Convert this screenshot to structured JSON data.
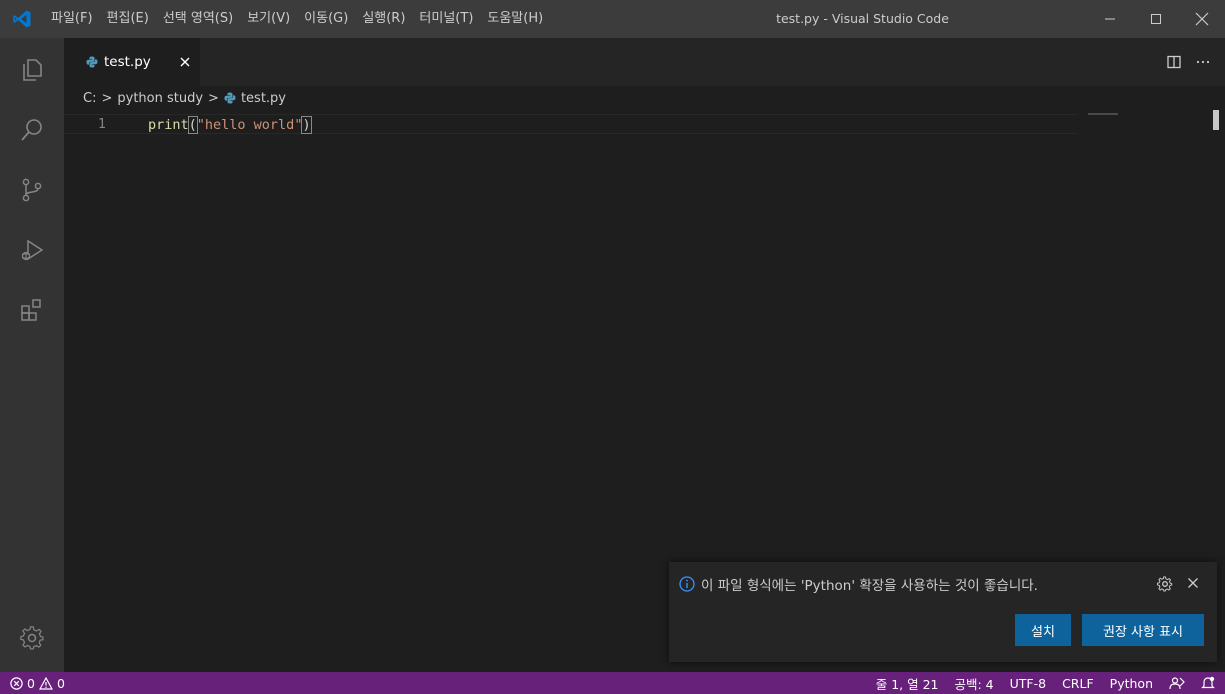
{
  "window": {
    "title": "test.py - Visual Studio Code",
    "controls": [
      "minimize-icon",
      "maximize-icon",
      "close-icon"
    ]
  },
  "menu": {
    "items": [
      {
        "label": "파일(F)"
      },
      {
        "label": "편집(E)"
      },
      {
        "label": "선택 영역(S)"
      },
      {
        "label": "보기(V)"
      },
      {
        "label": "이동(G)"
      },
      {
        "label": "실행(R)"
      },
      {
        "label": "터미널(T)"
      },
      {
        "label": "도움말(H)"
      }
    ]
  },
  "activity_bar": {
    "icons": [
      "explorer-icon",
      "search-icon",
      "source-control-icon",
      "run-debug-icon",
      "extensions-icon",
      "settings-gear-icon"
    ]
  },
  "tabs": [
    {
      "label": "test.py",
      "active": true
    }
  ],
  "breadcrumb": {
    "drive": "C:",
    "folder": "python study",
    "file": "test.py",
    "separator": ">"
  },
  "editor": {
    "lines": [
      {
        "number": "1",
        "fn": "print",
        "open": "(",
        "string": "\"hello world\"",
        "close": ")"
      }
    ]
  },
  "notification": {
    "message": "이 파일 형식에는 'Python' 확장을 사용하는 것이 좋습니다.",
    "install_label": "설치",
    "recommend_label": "권장 사항 표시"
  },
  "status_bar": {
    "errors": "0",
    "warnings": "0",
    "position": "줄 1, 열 21",
    "spaces": "공백: 4",
    "encoding": "UTF-8",
    "eol": "CRLF",
    "language": "Python"
  },
  "colors": {
    "statusbar": "#68217a",
    "button": "#0e639c",
    "vscode_blue": "#0078d4",
    "python_blue": "#519aba"
  }
}
